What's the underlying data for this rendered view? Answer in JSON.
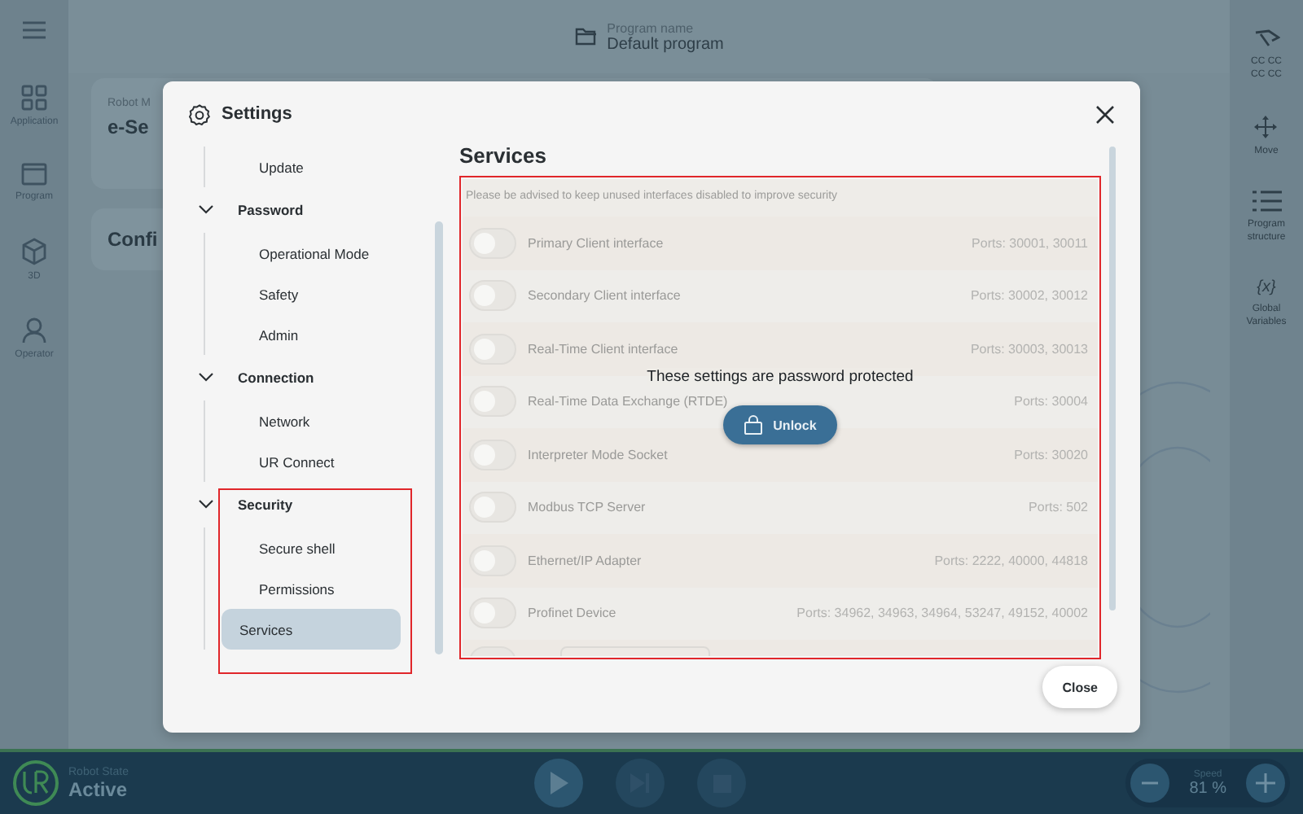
{
  "top_bar": {
    "program_label": "Program name",
    "program_name": "Default program"
  },
  "left_nav": [
    {
      "kind": "application",
      "label": "Application"
    },
    {
      "kind": "program",
      "label": "Program"
    },
    {
      "kind": "cube",
      "label": "3D"
    },
    {
      "kind": "operator",
      "label": "Operator"
    }
  ],
  "right_nav": [
    {
      "kind": "arm",
      "label_lines": [
        "CC CC",
        "CC CC"
      ]
    },
    {
      "kind": "move",
      "label_lines": [
        "Move"
      ]
    },
    {
      "kind": "structure",
      "label_lines": [
        "Program",
        "structure"
      ]
    },
    {
      "kind": "variables",
      "glyph": "{x}",
      "label_lines": [
        "Global",
        "Variables"
      ]
    }
  ],
  "cards": [
    {
      "caption": "Robot M",
      "title": "e-Se"
    },
    {
      "title": "Confi"
    }
  ],
  "dialog": {
    "title": "Settings",
    "heading": "Services",
    "nav": [
      {
        "children": [
          {
            "label": "Update",
            "selected": false
          }
        ]
      },
      {
        "label": "Password",
        "expanded": true,
        "children": [
          {
            "label": "Operational Mode",
            "selected": false
          },
          {
            "label": "Safety",
            "selected": false
          },
          {
            "label": "Admin",
            "selected": false
          }
        ]
      },
      {
        "label": "Connection",
        "expanded": true,
        "children": [
          {
            "label": "Network",
            "selected": false
          },
          {
            "label": "UR Connect",
            "selected": false
          }
        ]
      },
      {
        "label": "Security",
        "expanded": true,
        "children": [
          {
            "label": "Secure shell",
            "selected": false
          },
          {
            "label": "Permissions",
            "selected": false
          },
          {
            "label": "Services",
            "selected": true
          }
        ]
      }
    ],
    "notice": "Please be advised to keep unused interfaces disabled to improve security",
    "services": [
      {
        "name": "Primary Client interface",
        "ports": "Ports: 30001, 30011",
        "checked": false
      },
      {
        "name": "Secondary Client interface",
        "ports": "Ports: 30002, 30012",
        "checked": false
      },
      {
        "name": "Real-Time Client interface",
        "ports": "Ports: 30003, 30013",
        "checked": false
      },
      {
        "name": "Real-Time Data Exchange (RTDE)",
        "ports": "Ports: 30004",
        "checked": false
      },
      {
        "name": "Interpreter Mode Socket",
        "ports": "Ports: 30020",
        "checked": false
      },
      {
        "name": "Modbus TCP Server",
        "ports": "Ports: 502",
        "checked": false
      },
      {
        "name": "Ethernet/IP Adapter",
        "ports": "Ports: 2222, 40000, 44818",
        "checked": false
      },
      {
        "name": "Profinet Device",
        "ports": "Ports: 34962, 34963, 34964, 53247, 49152, 40002",
        "checked": false
      },
      {
        "checked": false
      }
    ],
    "lock_message": "These settings are password protected",
    "unlock_label": "Unlock",
    "close_label": "Close"
  },
  "bottom_bar": {
    "state_label": "Robot State",
    "state": "Active",
    "speed_label": "Speed",
    "speed": "81 %"
  }
}
